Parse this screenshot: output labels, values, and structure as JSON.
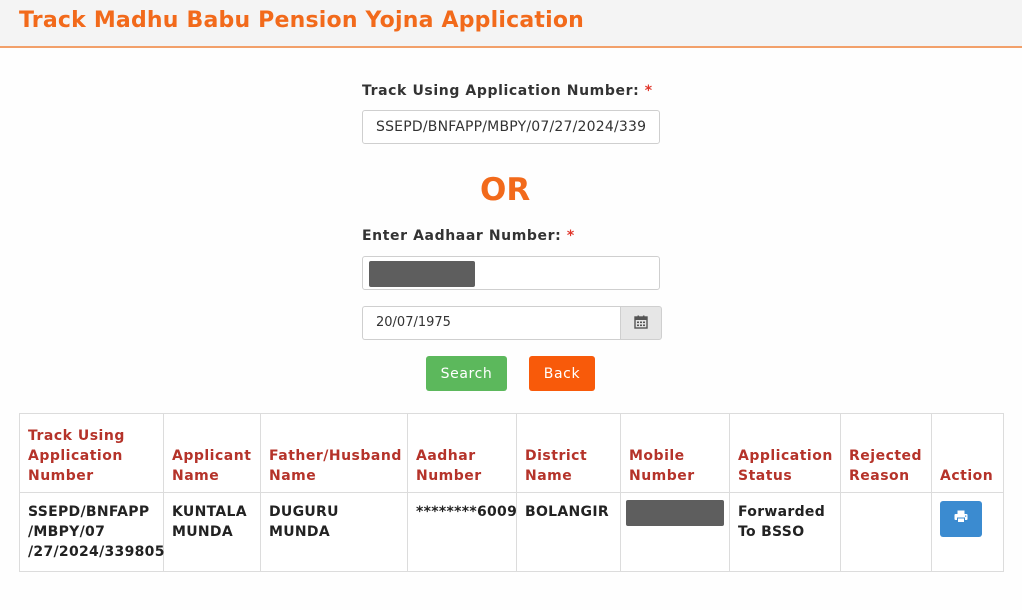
{
  "header": {
    "title": "Track Madhu Babu Pension Yojna Application"
  },
  "form": {
    "app_number_label": "Track Using Application Number:",
    "required_mark": "*",
    "app_number_value": "SSEPD/BNFAPP/MBPY/07/27/2024/339",
    "or_text": "OR",
    "aadhaar_label": "Enter Aadhaar Number:",
    "aadhaar_value": "",
    "dob_value": "20/07/1975",
    "search_label": "Search",
    "back_label": "Back"
  },
  "table": {
    "headers": [
      "Track Using Application Number",
      "Applicant Name",
      "Father/Husband Name",
      "Aadhar Number",
      "District Name",
      "Mobile Number",
      "Application Status",
      "Rejected Reason",
      "Action"
    ],
    "rows": [
      {
        "application_number": "SSEPD/BNFAPP /MBPY/07 /27/2024/339805",
        "applicant_name": "KUNTALA MUNDA",
        "father_husband_name": "DUGURU MUNDA",
        "aadhar_number": "********6009",
        "district_name": "BOLANGIR",
        "mobile_number": "",
        "application_status": "Forwarded To BSSO",
        "rejected_reason": ""
      }
    ]
  },
  "icons": {
    "calendar": "calendar-icon",
    "print": "print-icon"
  },
  "colors": {
    "accent": "#f26a1b",
    "header_text": "#b5332a",
    "search_button": "#5cb85c",
    "back_button": "#f85a0a",
    "print_button": "#3b8bd0"
  }
}
